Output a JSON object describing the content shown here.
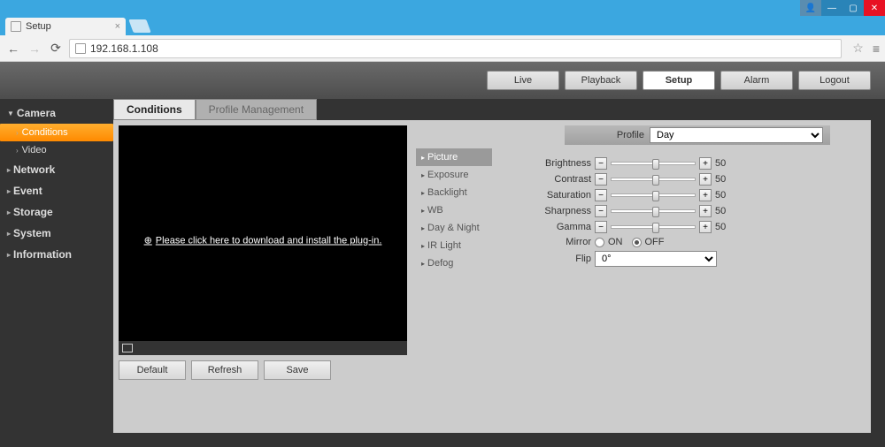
{
  "browser": {
    "tab_title": "Setup",
    "url": "192.168.1.108"
  },
  "header": {
    "tabs": {
      "live": "Live",
      "playback": "Playback",
      "setup": "Setup",
      "alarm": "Alarm",
      "logout": "Logout"
    }
  },
  "sidebar": {
    "camera": "Camera",
    "conditions": "Conditions",
    "video": "Video",
    "network": "Network",
    "event": "Event",
    "storage": "Storage",
    "system": "System",
    "information": "Information"
  },
  "tabs": {
    "conditions": "Conditions",
    "profile_mgmt": "Profile Management"
  },
  "video": {
    "plugin_msg": "Please click here to download and install the plug-in."
  },
  "actions": {
    "default": "Default",
    "refresh": "Refresh",
    "save": "Save"
  },
  "settings_list": {
    "picture": "Picture",
    "exposure": "Exposure",
    "backlight": "Backlight",
    "wb": "WB",
    "daynight": "Day & Night",
    "irlight": "IR Light",
    "defog": "Defog"
  },
  "controls": {
    "profile_label": "Profile",
    "profile_value": "Day",
    "brightness_label": "Brightness",
    "brightness_value": "50",
    "contrast_label": "Contrast",
    "contrast_value": "50",
    "saturation_label": "Saturation",
    "saturation_value": "50",
    "sharpness_label": "Sharpness",
    "sharpness_value": "50",
    "gamma_label": "Gamma",
    "gamma_value": "50",
    "mirror_label": "Mirror",
    "mirror_on": "ON",
    "mirror_off": "OFF",
    "flip_label": "Flip",
    "flip_value": "0°"
  }
}
